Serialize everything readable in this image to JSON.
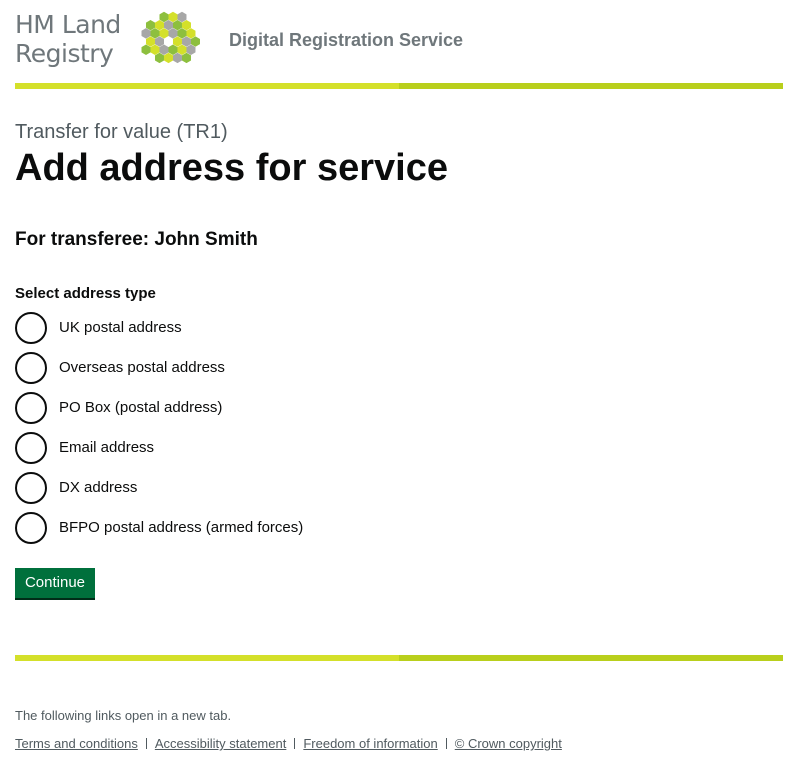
{
  "header": {
    "logo_line1": "HM Land",
    "logo_line2": "Registry",
    "logo_icon": "hexagon-cluster-icon",
    "service_name": "Digital Registration Service",
    "brand_colors": {
      "lime": "#d4e02a",
      "green": "#8dbf3e",
      "grey": "#a7a7a7"
    }
  },
  "page": {
    "caption": "Transfer for value (TR1)",
    "title": "Add address for service",
    "transferee": "For transferee: John Smith"
  },
  "form": {
    "legend": "Select address type",
    "options": [
      {
        "label": "UK postal address",
        "selected": false
      },
      {
        "label": "Overseas postal address",
        "selected": false
      },
      {
        "label": "PO Box (postal address)",
        "selected": false
      },
      {
        "label": "Email address",
        "selected": false
      },
      {
        "label": "DX address",
        "selected": false
      },
      {
        "label": "BFPO postal address (armed forces)",
        "selected": false
      }
    ],
    "continue_label": "Continue",
    "button_color": "#00703c"
  },
  "footer": {
    "note": "The following links open in a new tab.",
    "links": [
      {
        "label": "Terms and conditions"
      },
      {
        "label": "Accessibility statement"
      },
      {
        "label": "Freedom of information"
      },
      {
        "label": "© Crown copyright"
      }
    ]
  }
}
